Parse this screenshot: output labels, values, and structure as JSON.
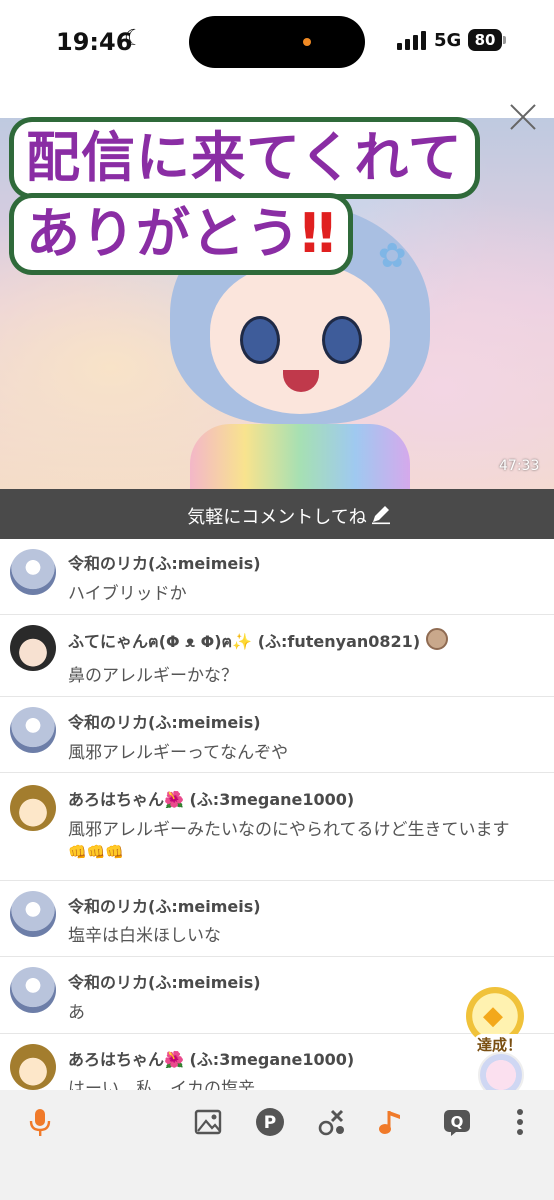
{
  "status_bar": {
    "time": "19:46",
    "network": "5G",
    "battery": "80"
  },
  "stream": {
    "caption_line1": "配信に来てくれて",
    "caption_line2": "ありがとう",
    "caption_exclaim": "‼",
    "elapsed": "47:33"
  },
  "comment_input": {
    "placeholder": "気軽にコメントしてね"
  },
  "comments": [
    {
      "name": "令和のリカ(ふ:meimeis)",
      "text": "ハイブリッドか"
    },
    {
      "name": "ふてにゃんฅ(Φ ᴥ Φ)ฅ✨ (ふ:futenyan0821)",
      "text": "鼻のアレルギーかな？"
    },
    {
      "name": "令和のリカ(ふ:meimeis)",
      "text": "風邪アレルギーってなんぞや"
    },
    {
      "name": "あろはちゃん🌺 (ふ:3megane1000)",
      "text": "風邪アレルギーみたいなのにやられてるけど生きています",
      "text2": "👊👊👊"
    },
    {
      "name": "令和のリカ(ふ:meimeis)",
      "text": "塩辛は白米ほしいな"
    },
    {
      "name": "令和のリカ(ふ:meimeis)",
      "text": "あ"
    },
    {
      "name": "あろはちゃん🌺 (ふ:3megane1000)",
      "text": "はーい、私、イカの塩辛"
    }
  ],
  "achievement": {
    "label": "達成！"
  },
  "icons": {
    "accent": "#f07a2a",
    "toolbar_bg": "#f1f1f1"
  }
}
